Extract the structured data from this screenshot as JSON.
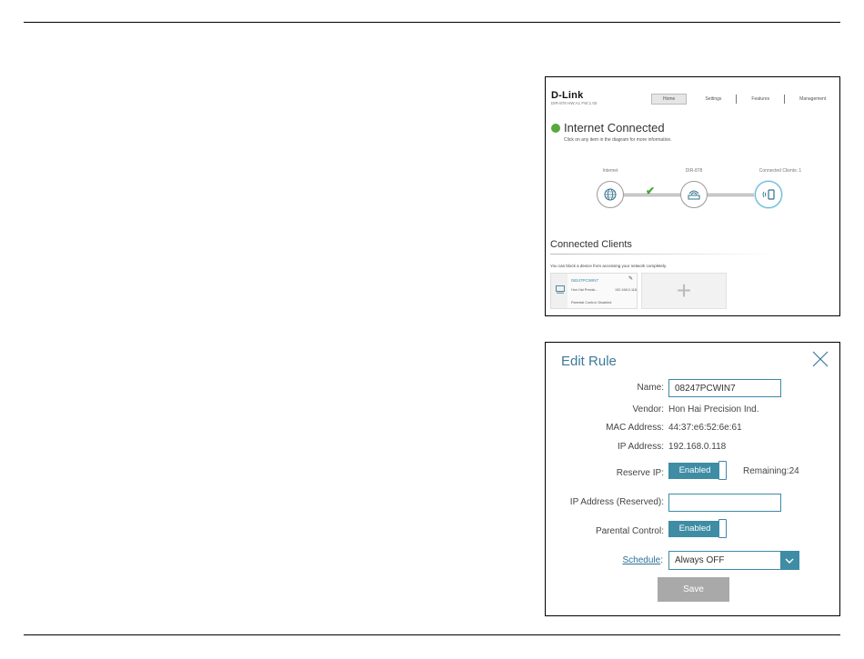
{
  "home": {
    "logo": "D-Link",
    "model": "DIR-878 HW:A1 FW:1.00",
    "nav": [
      "Home",
      "Settings",
      "Features",
      "Management"
    ],
    "status_title": "Internet Connected",
    "status_subtitle": "Click on any item in the diagram for more information.",
    "nodes": {
      "internet_label": "Internet",
      "router_label": "DIR-878",
      "clients_label": "Connected Clients: 1"
    },
    "connected_clients": {
      "title": "Connected Clients",
      "subtitle": "You can block a device from accessing your network completely.",
      "client": {
        "name": "08247PCWIN7",
        "vendor": "Hon Hai Precisi...",
        "ip": "192.168.0.118",
        "parental": "Parental Control: Disabled"
      },
      "add_glyph": "+"
    },
    "colors": {
      "connected": "#59a83c",
      "accent": "#3f8ca5"
    }
  },
  "edit_rule": {
    "title": "Edit Rule",
    "name_label": "Name:",
    "name_value": "08247PCWIN7",
    "vendor_label": "Vendor:",
    "vendor_value": "Hon Hai Precision Ind.",
    "mac_label": "MAC Address:",
    "mac_value": "44:37:e6:52:6e:61",
    "ip_label": "IP Address:",
    "ip_value": "192.168.0.118",
    "reserve_ip_label": "Reserve IP:",
    "reserve_ip_state": "Enabled",
    "remaining": "Remaining:24",
    "reserved_ip_label": "IP Address (Reserved):",
    "reserved_ip_value": "",
    "parental_label": "Parental Control:",
    "parental_state": "Enabled",
    "schedule_label": "Schedule",
    "schedule_colon": ":",
    "schedule_value": "Always OFF",
    "save_label": "Save"
  }
}
